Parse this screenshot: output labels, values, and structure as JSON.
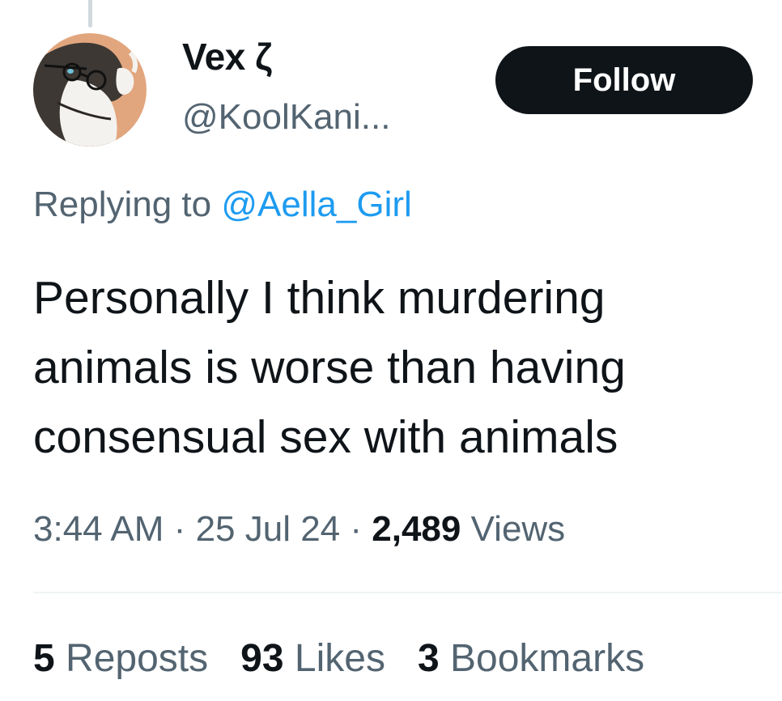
{
  "tweet": {
    "author": {
      "display_name": "Vex ζ",
      "handle": "@KoolKani..."
    },
    "follow_label": "Follow",
    "replying_prefix": "Replying to",
    "replying_to": "@Aella_Girl",
    "text": "Personally I think murdering animals is worse than having consensual sex with animals",
    "time": "3:44 AM",
    "date": "25 Jul 24",
    "separator": "·",
    "views_count": "2,489",
    "views_label": "Views",
    "stats": {
      "reposts_count": "5",
      "reposts_label": "Reposts",
      "likes_count": "93",
      "likes_label": "Likes",
      "bookmarks_count": "3",
      "bookmarks_label": "Bookmarks"
    }
  },
  "colors": {
    "text_primary": "#0f1419",
    "text_secondary": "#536471",
    "link": "#1d9bf0",
    "button_bg": "#0f1419",
    "button_text": "#ffffff",
    "divider": "#eff3f4",
    "thread_line": "#cfd9de",
    "avatar_bg": "#e2a67e"
  },
  "icons": {
    "avatar": "avatar-image-cartoon-character-with-glasses"
  }
}
